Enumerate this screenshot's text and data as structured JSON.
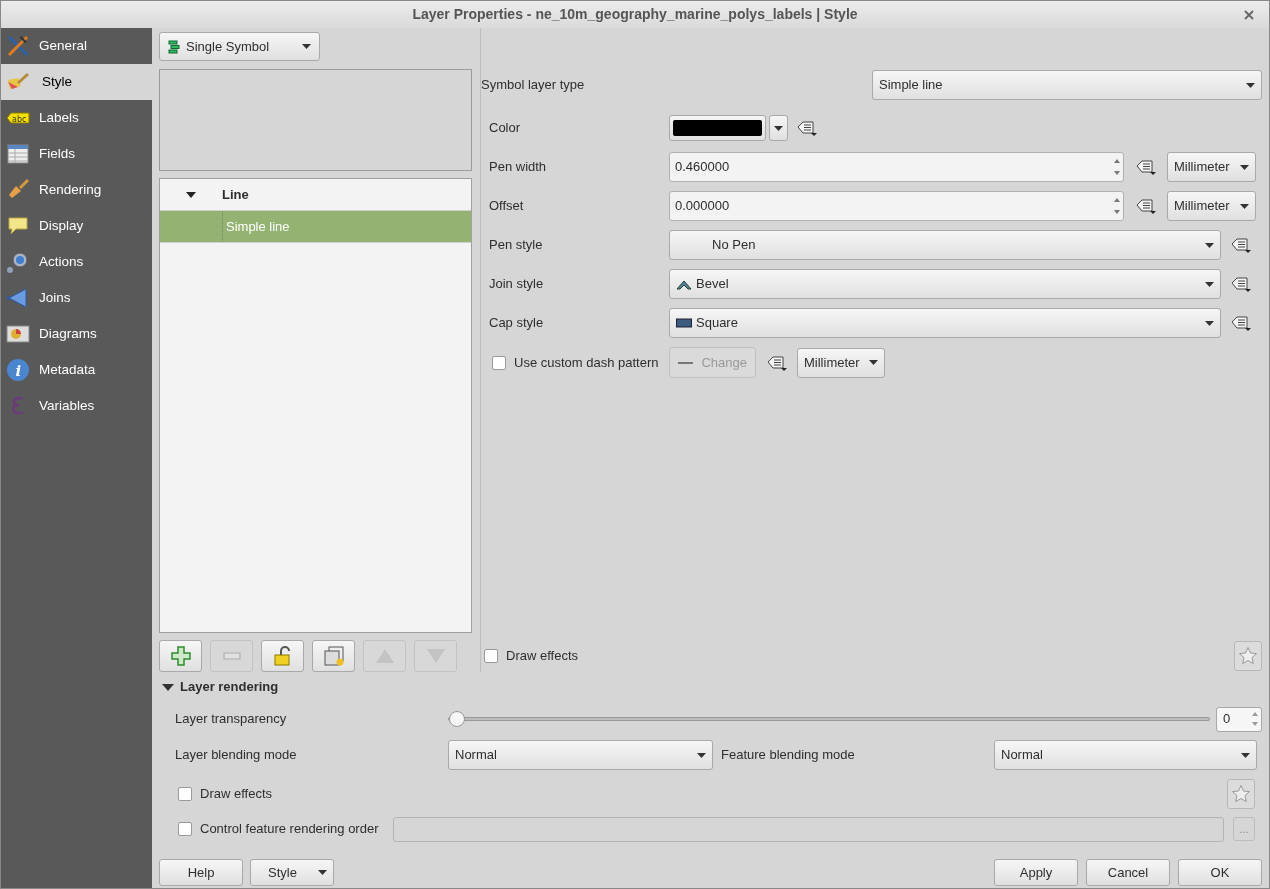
{
  "window": {
    "title": "Layer Properties - ne_10m_geography_marine_polys_labels | Style"
  },
  "sidebar": {
    "items": [
      {
        "label": "General",
        "selected": false
      },
      {
        "label": "Style",
        "selected": true
      },
      {
        "label": "Labels",
        "selected": false,
        "icon_text": "abc"
      },
      {
        "label": "Fields",
        "selected": false
      },
      {
        "label": "Rendering",
        "selected": false
      },
      {
        "label": "Display",
        "selected": false
      },
      {
        "label": "Actions",
        "selected": false
      },
      {
        "label": "Joins",
        "selected": false
      },
      {
        "label": "Diagrams",
        "selected": false
      },
      {
        "label": "Metadata",
        "selected": false,
        "icon_text": "i"
      },
      {
        "label": "Variables",
        "selected": false
      }
    ]
  },
  "renderer": {
    "value": "Single Symbol"
  },
  "symbol_tree": {
    "items": [
      {
        "label": "Line",
        "expanded": true,
        "children": [
          {
            "label": "Simple line",
            "selected": true
          }
        ]
      }
    ]
  },
  "symbol_toolbar": [
    {
      "kind": "add",
      "disabled": false
    },
    {
      "kind": "remove",
      "disabled": true
    },
    {
      "kind": "lock",
      "disabled": false
    },
    {
      "kind": "duplicate",
      "disabled": false
    },
    {
      "kind": "up",
      "disabled": true
    },
    {
      "kind": "down",
      "disabled": true
    }
  ],
  "symbol_layer_type": {
    "label": "Symbol layer type",
    "value": "Simple line"
  },
  "properties": [
    {
      "kind": "color",
      "label": "Color",
      "color": "#000000"
    },
    {
      "kind": "spin",
      "label": "Pen width",
      "value": "0.460000",
      "unit": "Millimeter"
    },
    {
      "kind": "spin",
      "label": "Offset",
      "value": "0.000000",
      "unit": "Millimeter"
    },
    {
      "kind": "combo",
      "label": "Pen style",
      "value": "No Pen"
    },
    {
      "kind": "combo",
      "label": "Join style",
      "value": "Bevel"
    },
    {
      "kind": "combo",
      "label": "Cap style",
      "value": "Square"
    },
    {
      "kind": "dash",
      "label": "Use custom dash pattern",
      "checked": false,
      "button": "Change",
      "unit": "Millimeter"
    }
  ],
  "symbol_draw_effects": {
    "label": "Draw effects",
    "checked": false
  },
  "layer_rendering": {
    "title": "Layer rendering",
    "expanded": true,
    "transparency": {
      "label": "Layer transparency",
      "level": 0,
      "value": "0"
    },
    "layer_blending": {
      "label": "Layer blending mode",
      "value": "Normal"
    },
    "feature_blending": {
      "label": "Feature blending mode",
      "value": "Normal"
    },
    "draw_effects": {
      "label": "Draw effects",
      "checked": false
    },
    "rendering_order": {
      "label": "Control feature rendering order",
      "checked": false,
      "button": "..."
    }
  },
  "footer": {
    "help": "Help",
    "style": "Style",
    "buttons": [
      "Apply",
      "Cancel",
      "OK"
    ]
  }
}
